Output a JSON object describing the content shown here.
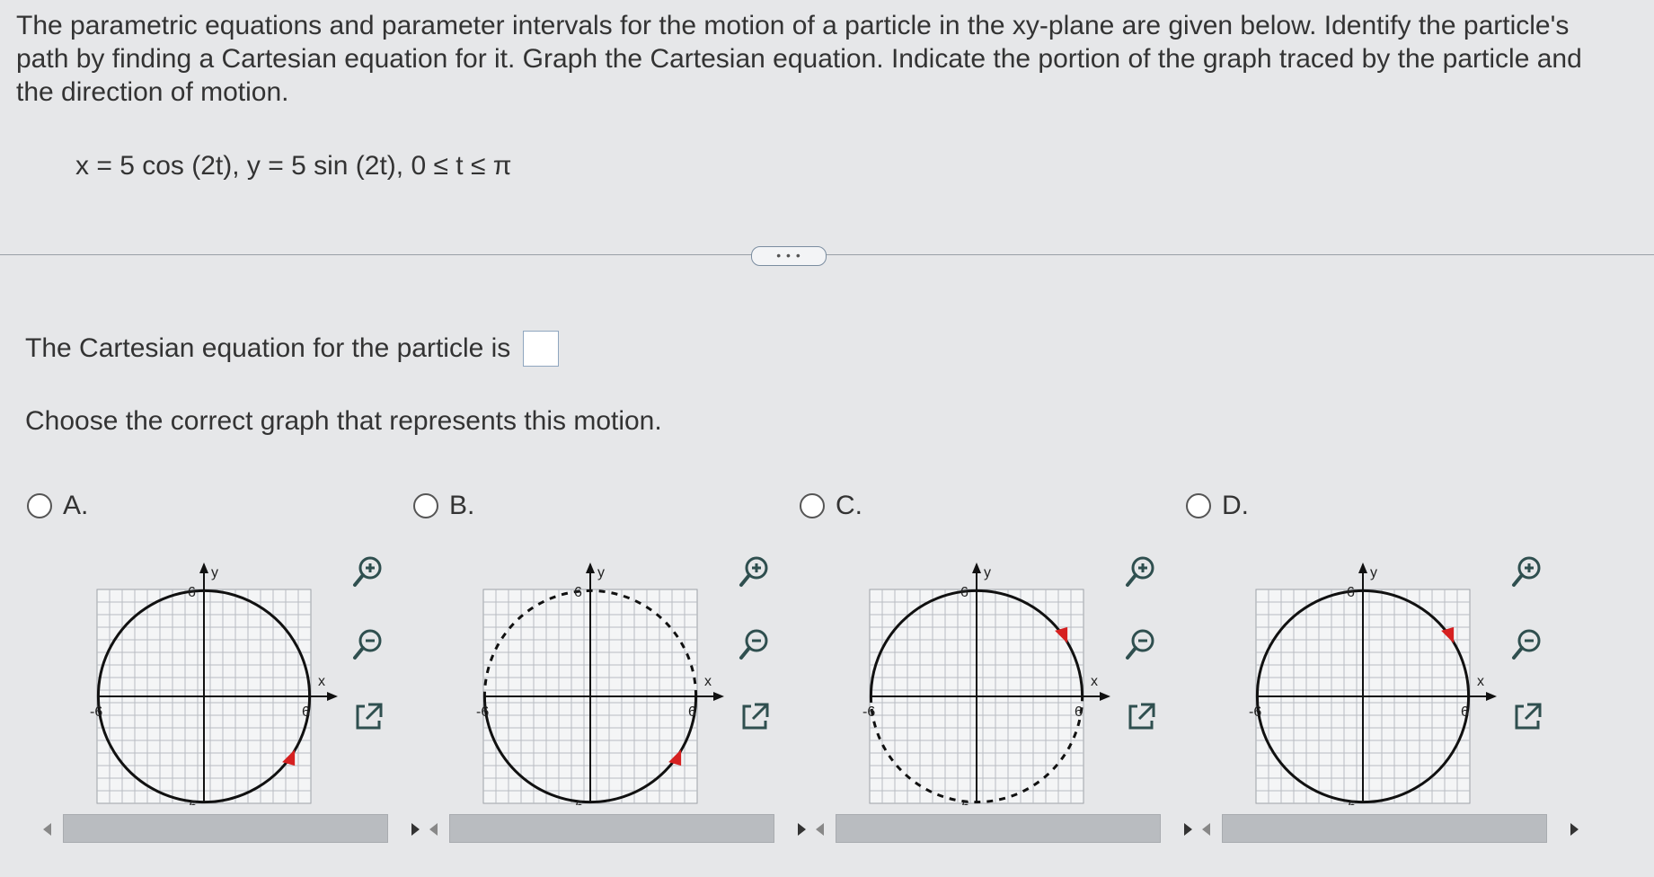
{
  "question": {
    "text": "The parametric equations and parameter intervals for the motion of a particle in the xy-plane are given below. Identify the particle's path by finding a Cartesian equation for it. Graph the Cartesian equation. Indicate the portion of the graph traced by the particle and the direction of motion.",
    "equation": "x = 5 cos (2t), y = 5 sin (2t), 0 ≤ t ≤ π"
  },
  "more_button": "• • •",
  "answer": {
    "prefix": "The Cartesian equation for the particle is"
  },
  "choose_prompt": "Choose the correct graph that represents this motion.",
  "options": [
    {
      "label": "A.",
      "axis": {
        "y": "y",
        "x": "x",
        "pos": "6",
        "neg": "-6"
      },
      "style": "solid",
      "arrow": "lower-right"
    },
    {
      "label": "B.",
      "axis": {
        "y": "y",
        "x": "x",
        "pos": "6",
        "neg": "-6"
      },
      "style": "dash-top",
      "arrow": "lower-right"
    },
    {
      "label": "C.",
      "axis": {
        "y": "y",
        "x": "x",
        "pos": "6",
        "neg": "-6"
      },
      "style": "dash-bottom",
      "arrow": "upper-right"
    },
    {
      "label": "D.",
      "axis": {
        "y": "y",
        "x": "x",
        "pos": "6",
        "neg": "-6"
      },
      "style": "solid",
      "arrow": "upper-right"
    }
  ],
  "colors": {
    "arrow": "#d62020",
    "grid": "#b8bcc2",
    "curve": "#111111"
  },
  "icons": [
    "zoom-in-icon",
    "zoom-out-icon",
    "open-new-window-icon"
  ]
}
